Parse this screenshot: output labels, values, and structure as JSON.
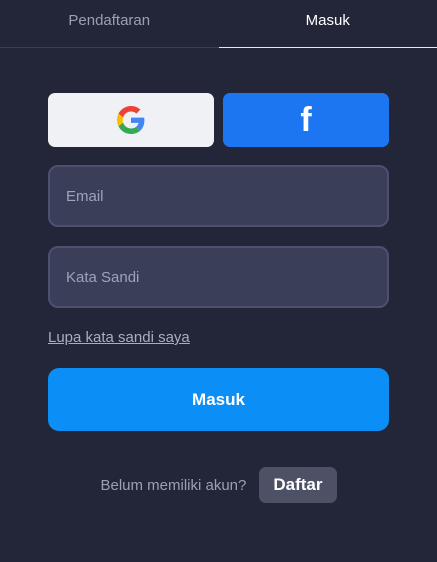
{
  "tabs": [
    {
      "label": "Pendaftaran",
      "active": false
    },
    {
      "label": "Masuk",
      "active": true
    }
  ],
  "social": {
    "google_icon": "google-icon",
    "facebook_icon": "facebook-icon",
    "facebook_glyph": "f"
  },
  "form": {
    "email_placeholder": "Email",
    "email_value": "",
    "password_placeholder": "Kata Sandi",
    "password_value": "",
    "forgot_password": "Lupa kata sandi saya",
    "submit_label": "Masuk"
  },
  "signup": {
    "prompt": "Belum memiliki akun?",
    "button_label": "Daftar"
  },
  "colors": {
    "background": "#232638",
    "primary": "#0b8ff7",
    "facebook": "#1c76f2",
    "field_bg": "#3a3e58",
    "secondary_button": "#4d5166"
  }
}
